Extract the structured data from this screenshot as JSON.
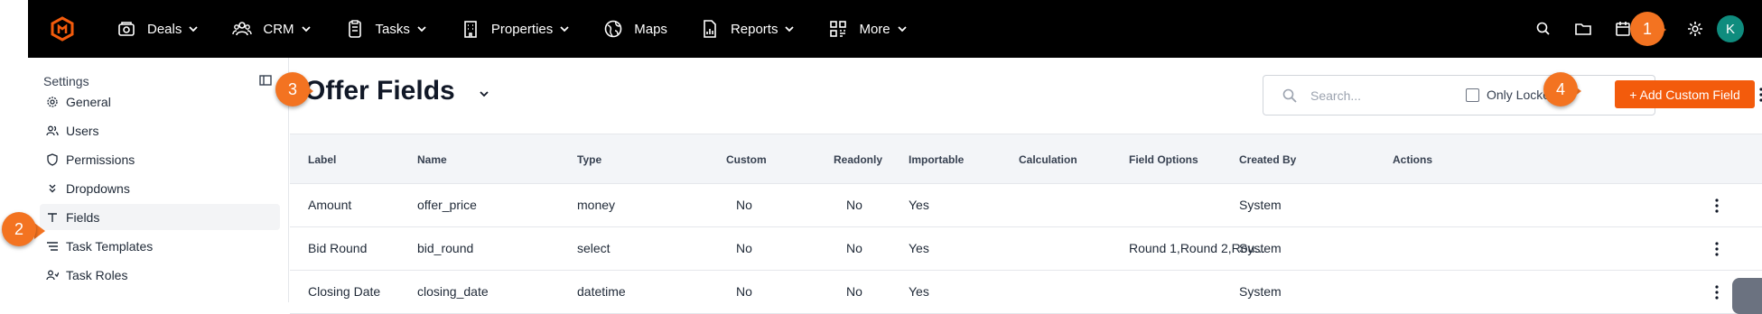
{
  "topnav": {
    "items": [
      {
        "label": "Deals",
        "icon": "deals-icon"
      },
      {
        "label": "CRM",
        "icon": "crm-icon"
      },
      {
        "label": "Tasks",
        "icon": "tasks-icon"
      },
      {
        "label": "Properties",
        "icon": "properties-icon"
      },
      {
        "label": "Maps",
        "icon": "maps-icon"
      },
      {
        "label": "Reports",
        "icon": "reports-icon"
      },
      {
        "label": "More",
        "icon": "more-icon"
      }
    ],
    "avatar_initial": "K"
  },
  "sidebar": {
    "title": "Settings",
    "items": [
      {
        "label": "General",
        "icon": "gear-icon"
      },
      {
        "label": "Users",
        "icon": "users-icon"
      },
      {
        "label": "Permissions",
        "icon": "shield-icon"
      },
      {
        "label": "Dropdowns",
        "icon": "dropdown-icon"
      },
      {
        "label": "Fields",
        "icon": "fields-icon",
        "active": true
      },
      {
        "label": "Task Templates",
        "icon": "task-templates-icon"
      },
      {
        "label": "Task Roles",
        "icon": "task-roles-icon"
      }
    ]
  },
  "main": {
    "title": "Offer Fields",
    "search_placeholder": "Search...",
    "only_locked_label": "Only Locke",
    "add_button_label": "+ Add Custom Field"
  },
  "table": {
    "columns": [
      "Label",
      "Name",
      "Type",
      "Custom",
      "Readonly",
      "Importable",
      "Calculation",
      "Field Options",
      "Created By",
      "Actions"
    ],
    "rows": [
      [
        "Amount",
        "offer_price",
        "money",
        "No",
        "No",
        "Yes",
        "",
        "",
        "System"
      ],
      [
        "Bid Round",
        "bid_round",
        "select",
        "No",
        "No",
        "Yes",
        "",
        "Round 1,Round 2,Rou...",
        "System"
      ],
      [
        "Closing Date",
        "closing_date",
        "datetime",
        "No",
        "No",
        "Yes",
        "",
        "",
        "System"
      ]
    ]
  },
  "callouts": [
    "1",
    "2",
    "3",
    "4"
  ],
  "colors": {
    "accent": "#f35b0c",
    "callout": "#f37321",
    "avatar": "#0f8c7e",
    "topbar": "#000000"
  }
}
